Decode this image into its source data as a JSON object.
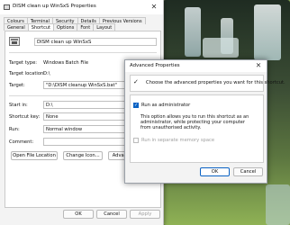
{
  "window": {
    "title": "DISM clean up WinSxS Properties",
    "close_glyph": "✕",
    "tabs_row1": [
      "Colours",
      "Terminal",
      "Security",
      "Details",
      "Previous Versions"
    ],
    "tabs_row2": [
      "General",
      "Shortcut",
      "Options",
      "Font",
      "Layout"
    ],
    "active_tab": "Shortcut",
    "shortcut_name": "DISM clean up WinSxS",
    "target_type_label": "Target type:",
    "target_type_value": "Windows Batch File",
    "target_location_label": "Target location:",
    "target_location_value": "D:\\",
    "target_label": "Target:",
    "target_value": "\"D:\\DISM cleanup WinSxS.bat\"",
    "start_in_label": "Start in:",
    "start_in_value": "D:\\",
    "shortcut_key_label": "Shortcut key:",
    "shortcut_key_value": "None",
    "run_label": "Run:",
    "run_value": "Normal window",
    "comment_label": "Comment:",
    "comment_value": "",
    "buttons": {
      "open_file_location": "Open File Location",
      "change_icon": "Change Icon...",
      "advanced": "Advanced..."
    },
    "footer": {
      "ok": "OK",
      "cancel": "Cancel",
      "apply": "Apply"
    }
  },
  "dialog": {
    "title": "Advanced Properties",
    "close_glyph": "✕",
    "info_text": "Choose the advanced properties you want for this shortcut.",
    "run_as_admin_label": "Run as administrator",
    "run_as_admin_checked": true,
    "description": "This option allows you to run this shortcut as an administrator, while protecting your computer from unauthorised activity.",
    "separate_memory_label": "Run in separate memory space",
    "separate_memory_checked": false,
    "ok": "OK",
    "cancel": "Cancel"
  },
  "colors": {
    "accent": "#0a62c4",
    "window_bg": "#f3f3f3",
    "panel_bg": "#ffffff"
  }
}
